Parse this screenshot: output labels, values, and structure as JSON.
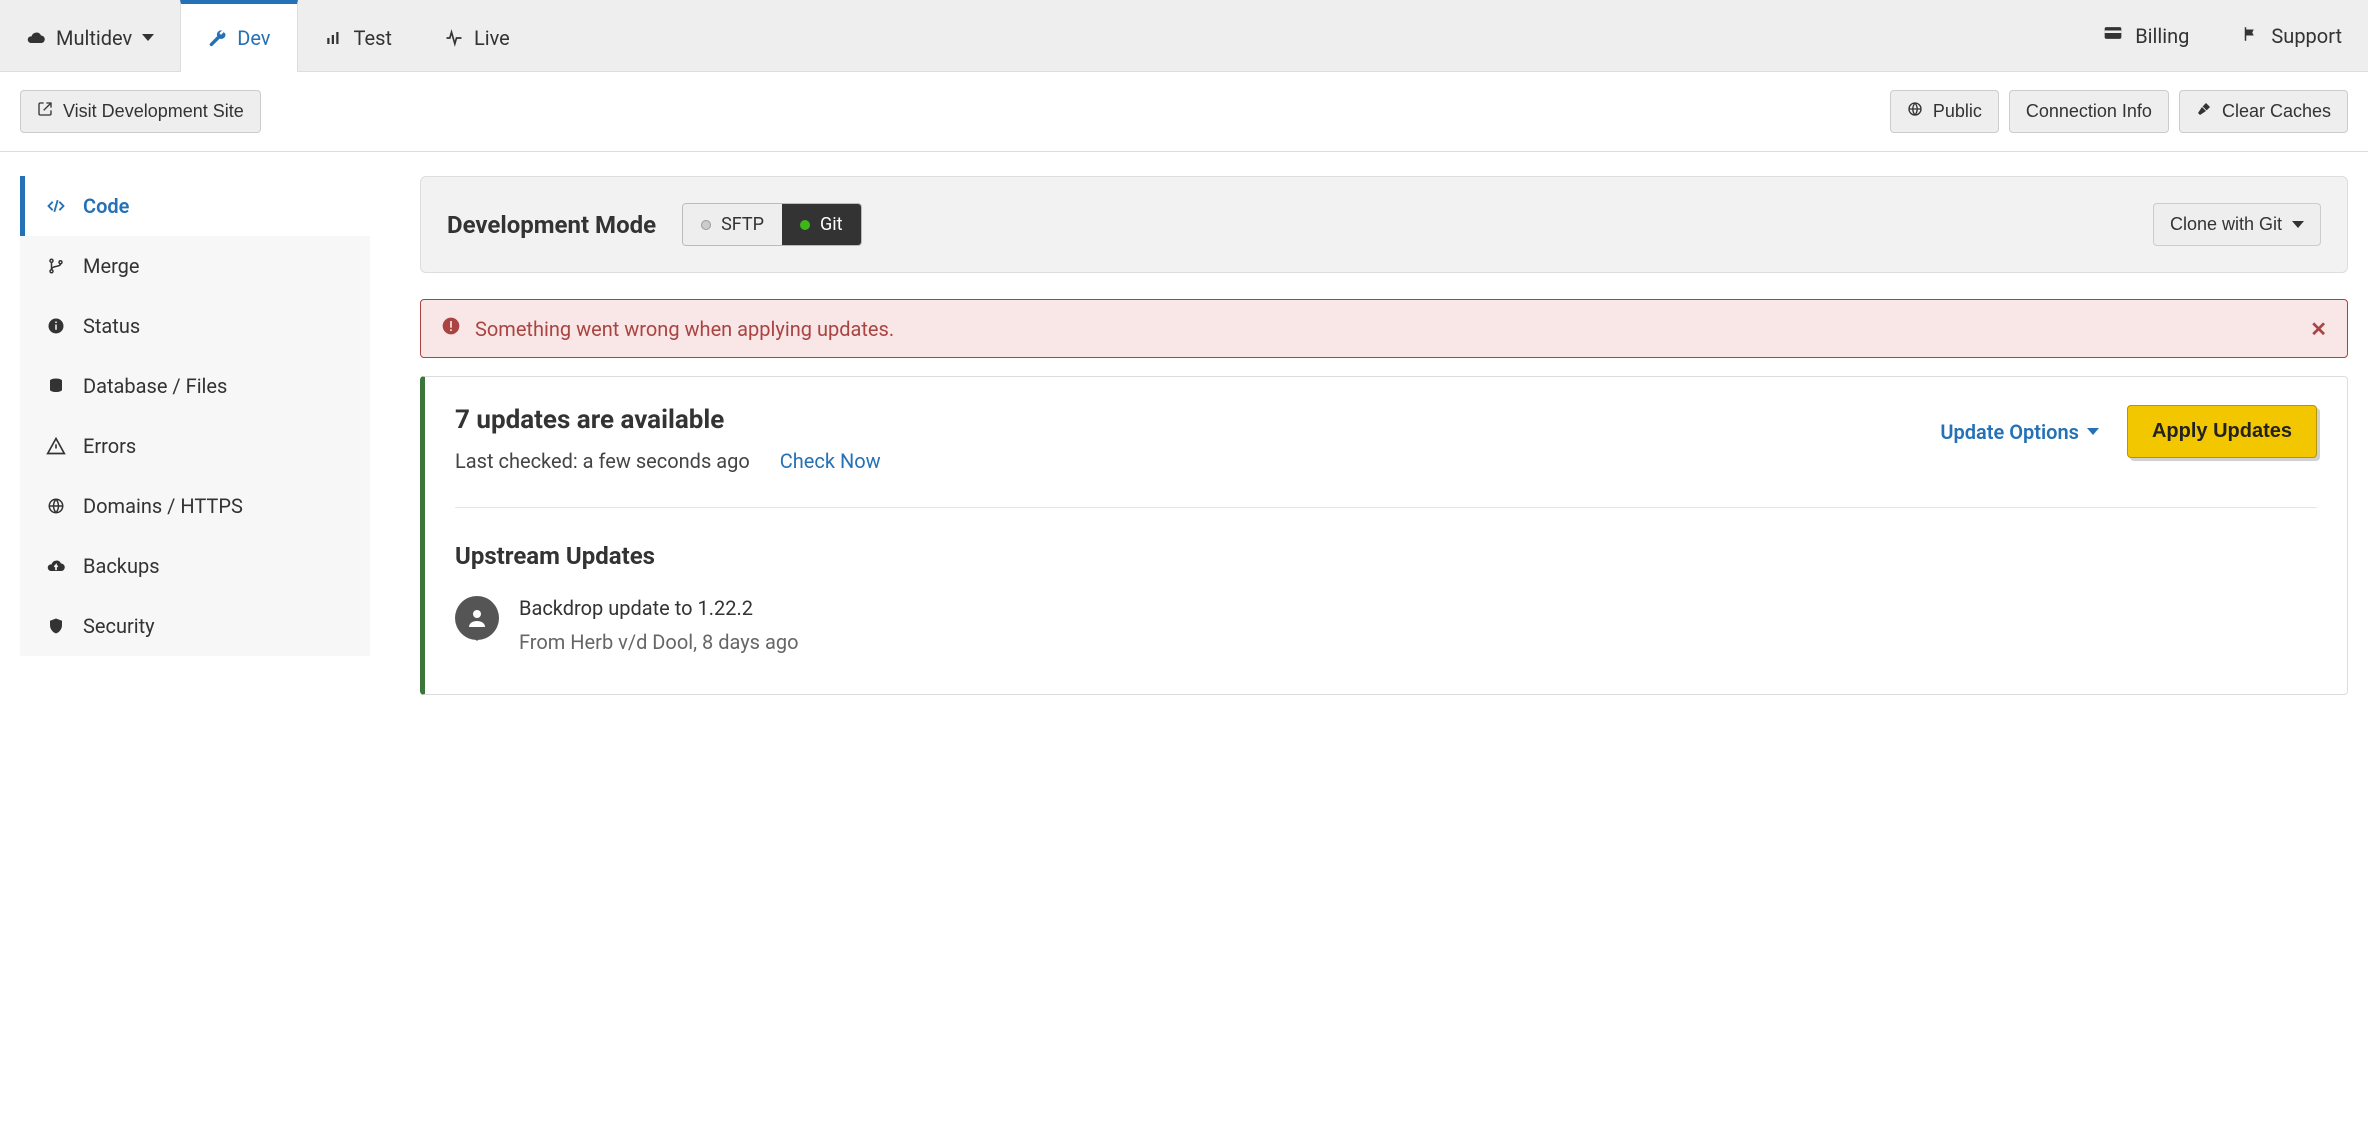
{
  "topbar": {
    "tabs": {
      "multidev": "Multidev",
      "dev": "Dev",
      "test": "Test",
      "live": "Live"
    },
    "billing": "Billing",
    "support": "Support"
  },
  "subbar": {
    "visit": "Visit Development Site",
    "public": "Public",
    "connection_info": "Connection Info",
    "clear_caches": "Clear Caches"
  },
  "sidebar": {
    "items": [
      {
        "key": "code",
        "label": "Code"
      },
      {
        "key": "merge",
        "label": "Merge"
      },
      {
        "key": "status",
        "label": "Status"
      },
      {
        "key": "database-files",
        "label": "Database / Files"
      },
      {
        "key": "errors",
        "label": "Errors"
      },
      {
        "key": "domains-https",
        "label": "Domains / HTTPS"
      },
      {
        "key": "backups",
        "label": "Backups"
      },
      {
        "key": "security",
        "label": "Security"
      }
    ]
  },
  "devmode": {
    "title": "Development Mode",
    "options": {
      "sftp": "SFTP",
      "git": "Git"
    },
    "clone": "Clone with Git"
  },
  "alert": {
    "text": "Something went wrong when applying updates."
  },
  "updates": {
    "count_label": "7 updates are available",
    "last_checked_label": "Last checked: a few seconds ago",
    "check_now": "Check Now",
    "update_options": "Update Options",
    "apply": "Apply Updates",
    "upstream_title": "Upstream Updates",
    "commits": [
      {
        "title": "Backdrop update to 1.22.2",
        "meta": "From Herb v/d Dool, 8 days ago"
      }
    ]
  }
}
